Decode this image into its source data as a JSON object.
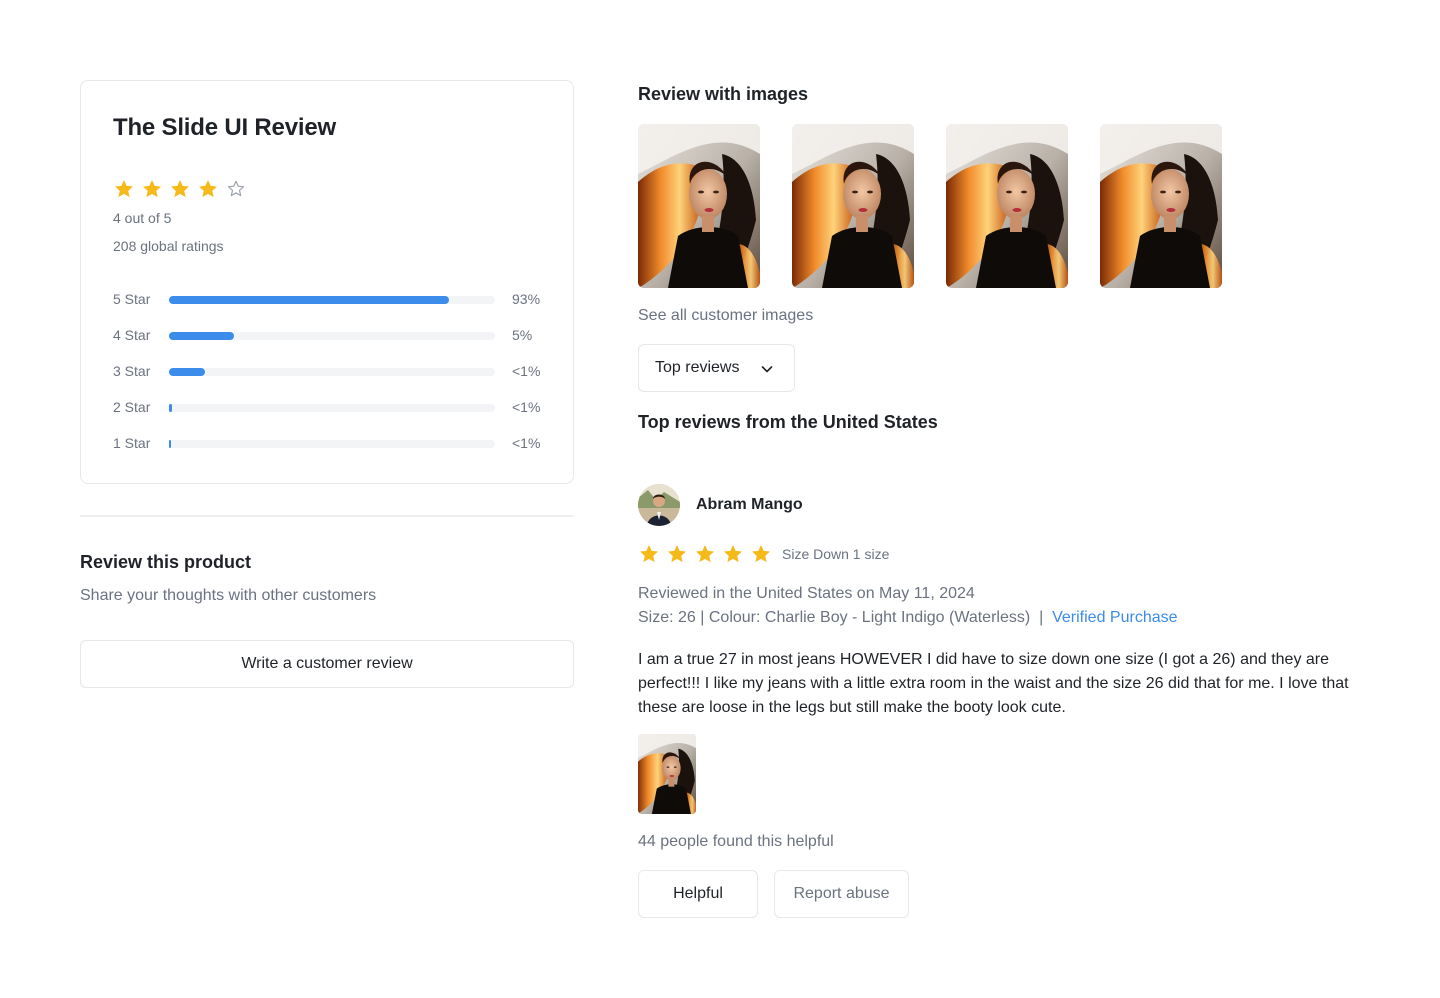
{
  "summary": {
    "title": "The Slide UI Review",
    "rating": 4,
    "rating_max": 5,
    "out_of_text": "4 out of 5",
    "global_ratings_text": "208  global ratings",
    "distribution": [
      {
        "label": "5 Star",
        "percent_text": "93%",
        "fill_fraction": 0.86
      },
      {
        "label": "4 Star",
        "percent_text": "5%",
        "fill_fraction": 0.2
      },
      {
        "label": "3 Star",
        "percent_text": "<1%",
        "fill_fraction": 0.11
      },
      {
        "label": "2 Star",
        "percent_text": "<1%",
        "fill_fraction": 0.008
      },
      {
        "label": "1 Star",
        "percent_text": "<1%",
        "fill_fraction": 0.006
      }
    ]
  },
  "review_product": {
    "title": "Review this product",
    "subtitle": "Share your thoughts with other customers",
    "write_button_label": "Write a customer review"
  },
  "images_section": {
    "title": "Review with images",
    "see_all_label": "See all customer images",
    "image_count": 4
  },
  "sort": {
    "selected": "Top reviews"
  },
  "reviews_section": {
    "title": "Top reviews from the United States"
  },
  "review": {
    "reviewer_name": "Abram Mango",
    "rating": 5,
    "headline": "Size Down 1 size",
    "date_text": "Reviewed in the United States on May 11, 2024",
    "meta_text": "Size: 26 | Colour: Charlie Boy - Light Indigo (Waterless)  |  ",
    "verified_text": "Verified Purchase",
    "body": "I am a true 27 in most jeans HOWEVER I did have to size down one size (I got a 26) and they are perfect!!! I like my jeans with a little extra room in the waist and the size 26 did that for me. I love that these are loose in the legs but still make the booty look cute.",
    "helpful_count_text": "44 people found this helpful",
    "helpful_label": "Helpful",
    "report_label": "Report abuse"
  },
  "colors": {
    "star": "#f6b91a",
    "accent": "#3b8ceb",
    "muted_text": "#6b7280",
    "border": "#e5e7eb"
  },
  "icons": {
    "star_filled": "star-icon",
    "star_empty": "star-outline-icon",
    "dropdown": "chevron-down-icon"
  }
}
